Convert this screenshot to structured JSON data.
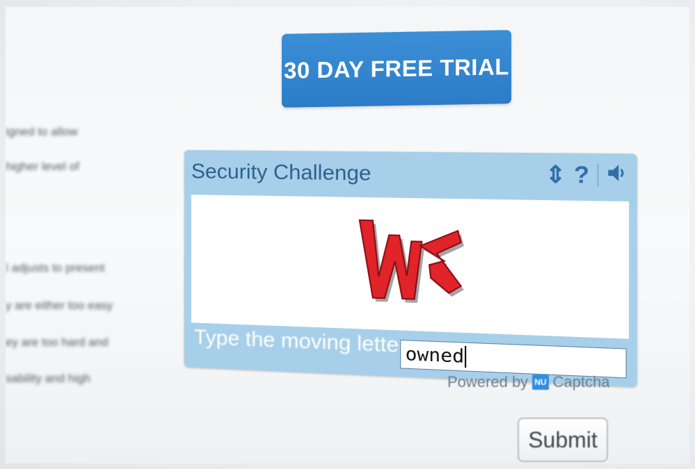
{
  "trial_button": {
    "label": "30 DAY FREE TRIAL",
    "color": "#2f80cc"
  },
  "left_text_lines": [
    "igned to allow",
    "higher level of",
    "l adjusts to present",
    "y are either too easy",
    "ey are too hard and",
    "sability and high"
  ],
  "captcha": {
    "title": "Security Challenge",
    "icons": [
      "refresh-icon",
      "help-icon",
      "audio-icon"
    ],
    "icon_glyphs": {
      "refresh": "⇕",
      "help": "?",
      "audio": "◀)"
    },
    "image_letters": "WZ",
    "prompt": "Type the moving letters:",
    "input_value": "owned",
    "frame_color": "#a7cfe9",
    "letter_color": "#e0242a"
  },
  "powered_by": {
    "prefix": "Powered by",
    "badge": "NU",
    "brand": "Captcha"
  },
  "submit": {
    "label": "Submit"
  }
}
